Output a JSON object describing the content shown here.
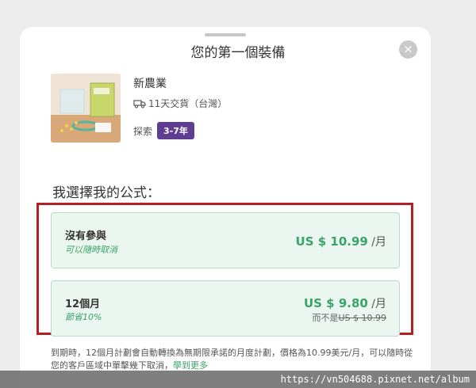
{
  "modal": {
    "title": "您的第一個裝備",
    "close_glyph": "×"
  },
  "product": {
    "name": "新農業",
    "shipping": "11天交貨（台灣）",
    "tag_label": "探索",
    "age_badge": "3-7年",
    "badge_color": "#5f3e91"
  },
  "plans": {
    "heading": "我選擇我的公式：",
    "items": [
      {
        "name": "沒有參與",
        "subtitle": "可以隨時取消",
        "price": "US $ 10.99",
        "unit": " /月",
        "original": ""
      },
      {
        "name": "12個月",
        "subtitle": "節省10%",
        "price": "US $ 9.80",
        "unit": " /月",
        "original_prefix": "而不是",
        "original": "US $ 10.99"
      }
    ],
    "accent_color": "#3aa369"
  },
  "footer": {
    "text": "到期時，12個月計劃會自動轉換為無期限承諾的月度計劃，價格為10.99美元/月，可以隨時從您的客戶區域中單擊幾下取消，",
    "link": "學到更多"
  },
  "watermark": "https://vn504688.pixnet.net/album"
}
